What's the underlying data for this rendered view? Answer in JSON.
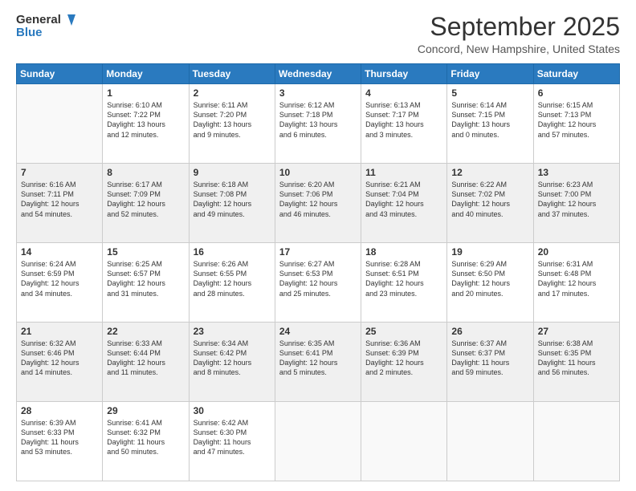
{
  "logo": {
    "line1": "General",
    "line2": "Blue"
  },
  "title": "September 2025",
  "location": "Concord, New Hampshire, United States",
  "days_header": [
    "Sunday",
    "Monday",
    "Tuesday",
    "Wednesday",
    "Thursday",
    "Friday",
    "Saturday"
  ],
  "weeks": [
    [
      {
        "day": "",
        "content": ""
      },
      {
        "day": "1",
        "content": "Sunrise: 6:10 AM\nSunset: 7:22 PM\nDaylight: 13 hours\nand 12 minutes."
      },
      {
        "day": "2",
        "content": "Sunrise: 6:11 AM\nSunset: 7:20 PM\nDaylight: 13 hours\nand 9 minutes."
      },
      {
        "day": "3",
        "content": "Sunrise: 6:12 AM\nSunset: 7:18 PM\nDaylight: 13 hours\nand 6 minutes."
      },
      {
        "day": "4",
        "content": "Sunrise: 6:13 AM\nSunset: 7:17 PM\nDaylight: 13 hours\nand 3 minutes."
      },
      {
        "day": "5",
        "content": "Sunrise: 6:14 AM\nSunset: 7:15 PM\nDaylight: 13 hours\nand 0 minutes."
      },
      {
        "day": "6",
        "content": "Sunrise: 6:15 AM\nSunset: 7:13 PM\nDaylight: 12 hours\nand 57 minutes."
      }
    ],
    [
      {
        "day": "7",
        "content": "Sunrise: 6:16 AM\nSunset: 7:11 PM\nDaylight: 12 hours\nand 54 minutes."
      },
      {
        "day": "8",
        "content": "Sunrise: 6:17 AM\nSunset: 7:09 PM\nDaylight: 12 hours\nand 52 minutes."
      },
      {
        "day": "9",
        "content": "Sunrise: 6:18 AM\nSunset: 7:08 PM\nDaylight: 12 hours\nand 49 minutes."
      },
      {
        "day": "10",
        "content": "Sunrise: 6:20 AM\nSunset: 7:06 PM\nDaylight: 12 hours\nand 46 minutes."
      },
      {
        "day": "11",
        "content": "Sunrise: 6:21 AM\nSunset: 7:04 PM\nDaylight: 12 hours\nand 43 minutes."
      },
      {
        "day": "12",
        "content": "Sunrise: 6:22 AM\nSunset: 7:02 PM\nDaylight: 12 hours\nand 40 minutes."
      },
      {
        "day": "13",
        "content": "Sunrise: 6:23 AM\nSunset: 7:00 PM\nDaylight: 12 hours\nand 37 minutes."
      }
    ],
    [
      {
        "day": "14",
        "content": "Sunrise: 6:24 AM\nSunset: 6:59 PM\nDaylight: 12 hours\nand 34 minutes."
      },
      {
        "day": "15",
        "content": "Sunrise: 6:25 AM\nSunset: 6:57 PM\nDaylight: 12 hours\nand 31 minutes."
      },
      {
        "day": "16",
        "content": "Sunrise: 6:26 AM\nSunset: 6:55 PM\nDaylight: 12 hours\nand 28 minutes."
      },
      {
        "day": "17",
        "content": "Sunrise: 6:27 AM\nSunset: 6:53 PM\nDaylight: 12 hours\nand 25 minutes."
      },
      {
        "day": "18",
        "content": "Sunrise: 6:28 AM\nSunset: 6:51 PM\nDaylight: 12 hours\nand 23 minutes."
      },
      {
        "day": "19",
        "content": "Sunrise: 6:29 AM\nSunset: 6:50 PM\nDaylight: 12 hours\nand 20 minutes."
      },
      {
        "day": "20",
        "content": "Sunrise: 6:31 AM\nSunset: 6:48 PM\nDaylight: 12 hours\nand 17 minutes."
      }
    ],
    [
      {
        "day": "21",
        "content": "Sunrise: 6:32 AM\nSunset: 6:46 PM\nDaylight: 12 hours\nand 14 minutes."
      },
      {
        "day": "22",
        "content": "Sunrise: 6:33 AM\nSunset: 6:44 PM\nDaylight: 12 hours\nand 11 minutes."
      },
      {
        "day": "23",
        "content": "Sunrise: 6:34 AM\nSunset: 6:42 PM\nDaylight: 12 hours\nand 8 minutes."
      },
      {
        "day": "24",
        "content": "Sunrise: 6:35 AM\nSunset: 6:41 PM\nDaylight: 12 hours\nand 5 minutes."
      },
      {
        "day": "25",
        "content": "Sunrise: 6:36 AM\nSunset: 6:39 PM\nDaylight: 12 hours\nand 2 minutes."
      },
      {
        "day": "26",
        "content": "Sunrise: 6:37 AM\nSunset: 6:37 PM\nDaylight: 11 hours\nand 59 minutes."
      },
      {
        "day": "27",
        "content": "Sunrise: 6:38 AM\nSunset: 6:35 PM\nDaylight: 11 hours\nand 56 minutes."
      }
    ],
    [
      {
        "day": "28",
        "content": "Sunrise: 6:39 AM\nSunset: 6:33 PM\nDaylight: 11 hours\nand 53 minutes."
      },
      {
        "day": "29",
        "content": "Sunrise: 6:41 AM\nSunset: 6:32 PM\nDaylight: 11 hours\nand 50 minutes."
      },
      {
        "day": "30",
        "content": "Sunrise: 6:42 AM\nSunset: 6:30 PM\nDaylight: 11 hours\nand 47 minutes."
      },
      {
        "day": "",
        "content": ""
      },
      {
        "day": "",
        "content": ""
      },
      {
        "day": "",
        "content": ""
      },
      {
        "day": "",
        "content": ""
      }
    ]
  ]
}
